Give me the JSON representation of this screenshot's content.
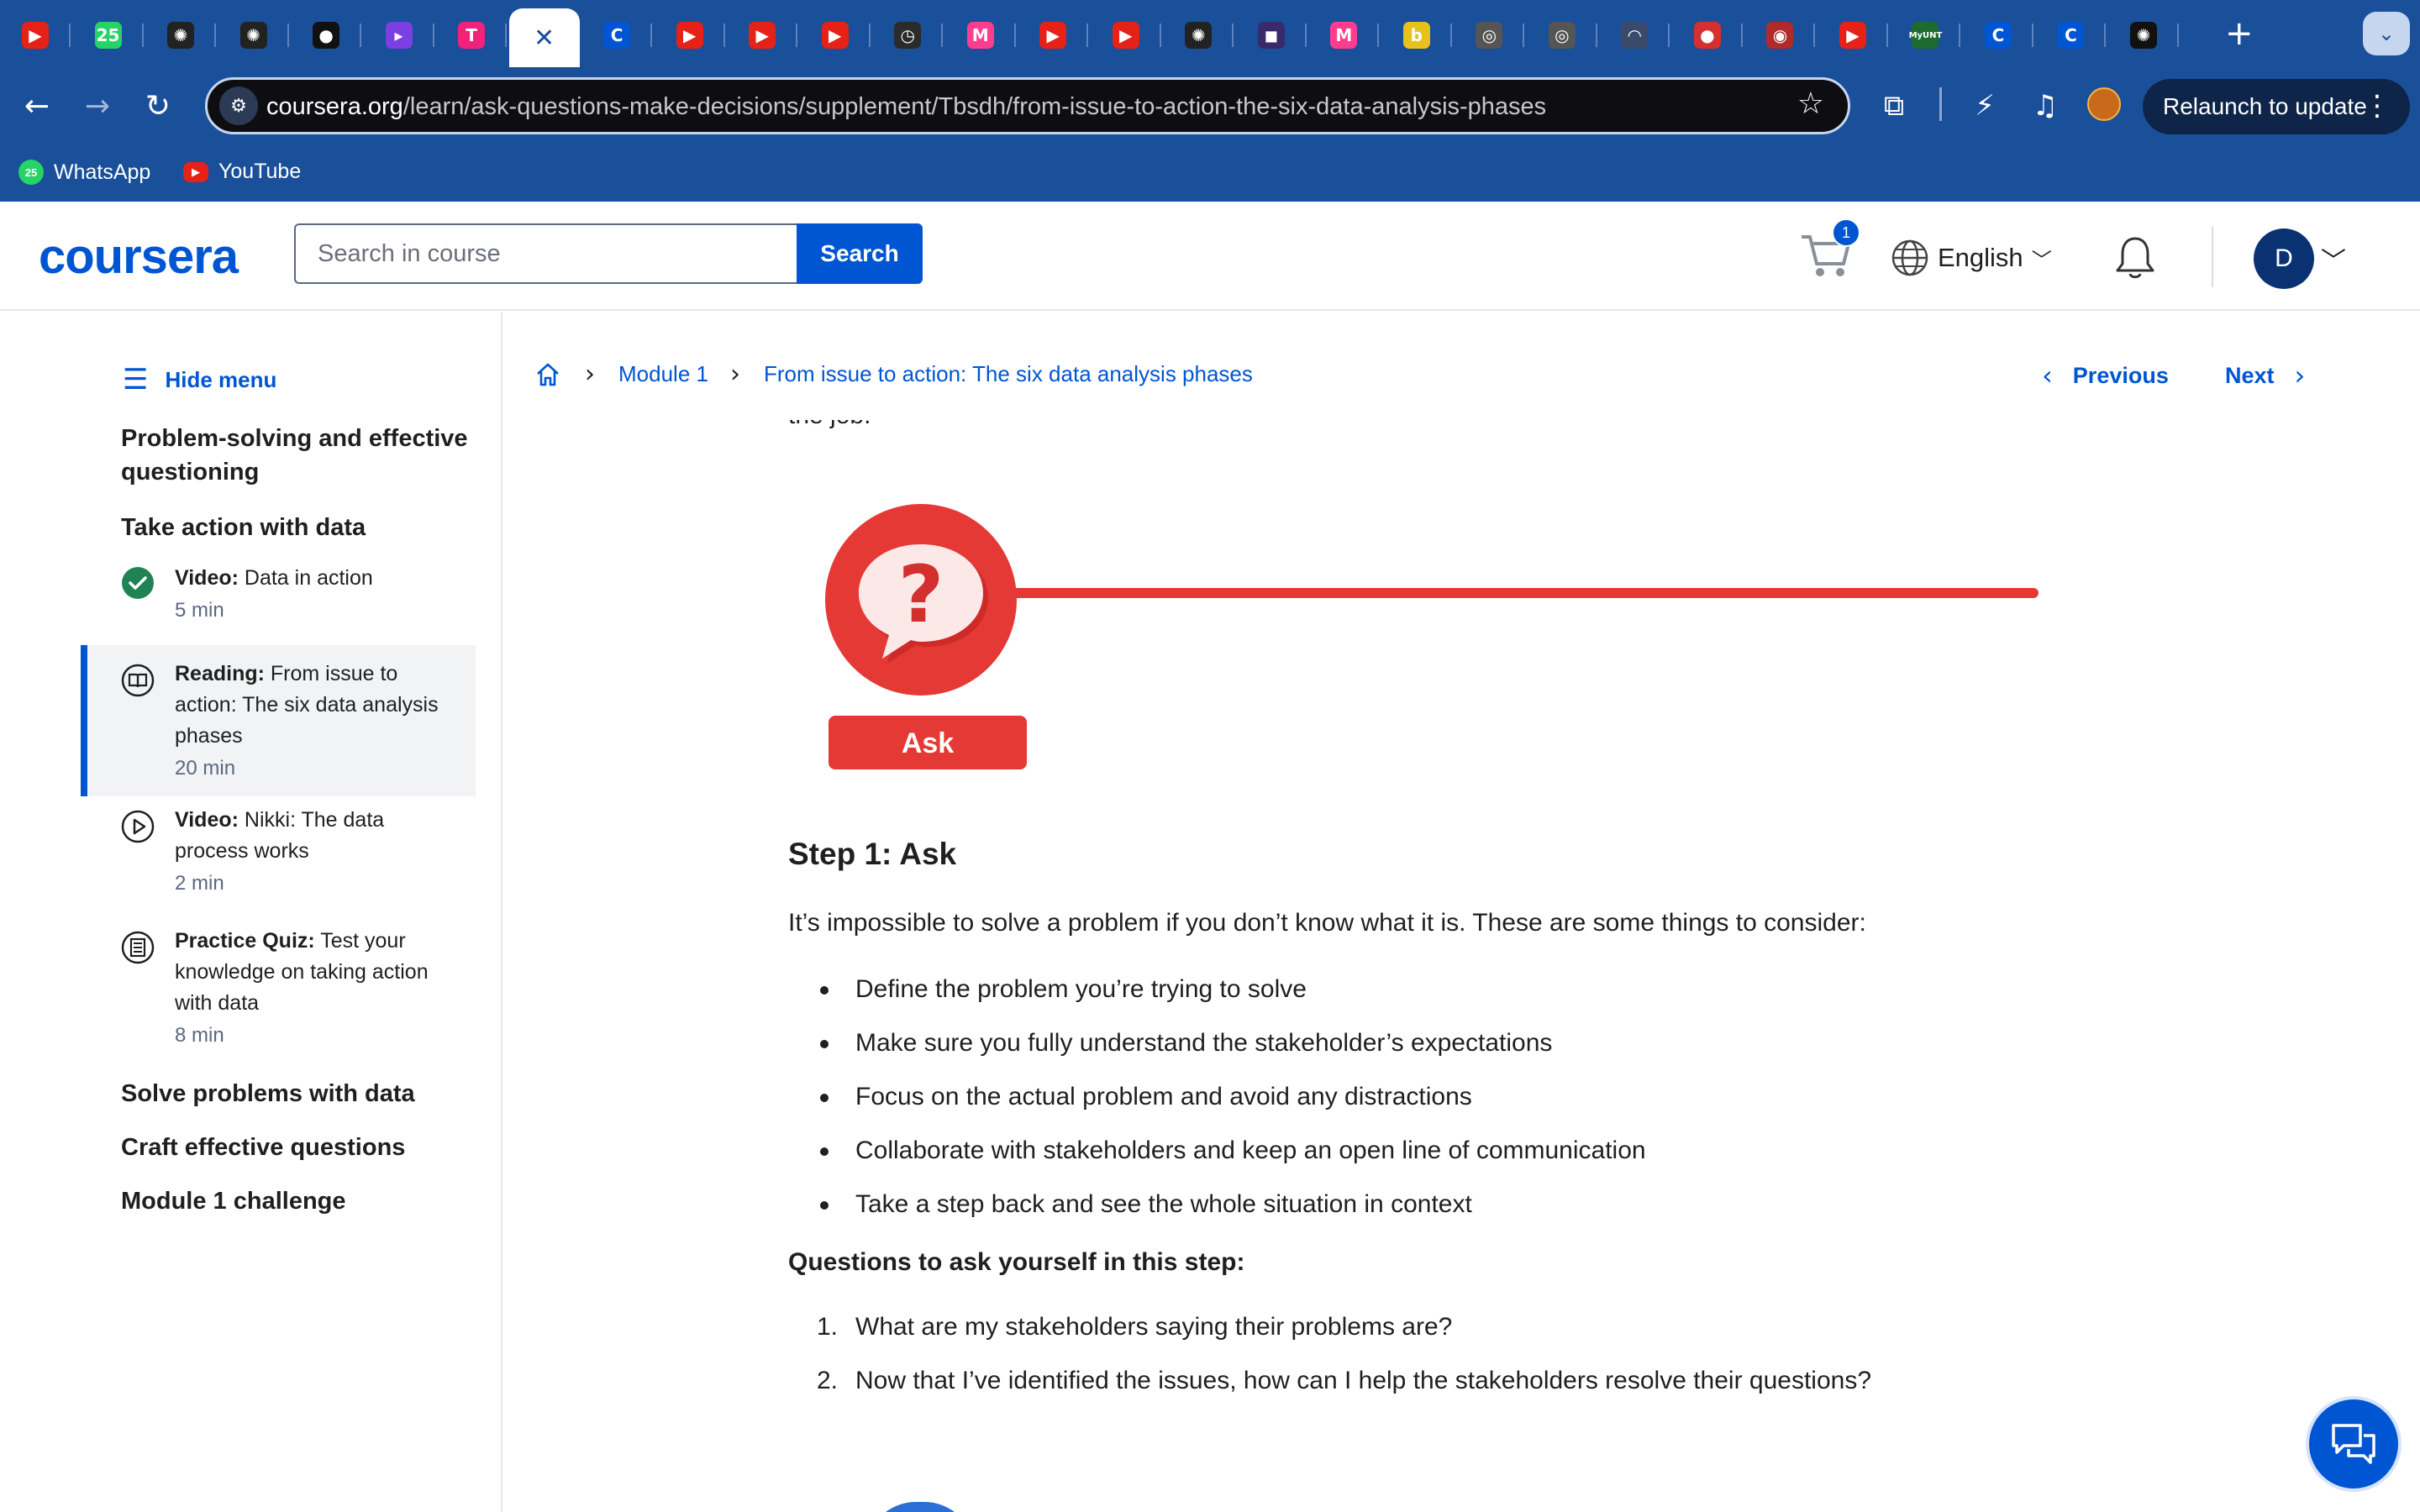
{
  "browser": {
    "tabs": [
      {
        "icon": "youtube-icon",
        "color": "#e62117",
        "glyph": "▶"
      },
      {
        "icon": "whatsapp-icon",
        "color": "#25d366",
        "glyph": "25"
      },
      {
        "icon": "openai-icon",
        "color": "#222222",
        "glyph": "✺"
      },
      {
        "icon": "openai-icon",
        "color": "#222222",
        "glyph": "✺"
      },
      {
        "icon": "github-icon",
        "color": "#111111",
        "glyph": "●"
      },
      {
        "icon": "app-icon",
        "color": "#7b3fe4",
        "glyph": "▸"
      },
      {
        "icon": "tasks-icon",
        "color": "#f0227a",
        "glyph": "T"
      },
      {
        "icon": "close-icon",
        "active": true,
        "glyph": "✕"
      },
      {
        "icon": "coursera-icon",
        "color": "#0056d2",
        "glyph": "C"
      },
      {
        "icon": "youtube-icon",
        "color": "#e62117",
        "glyph": "▶"
      },
      {
        "icon": "youtube-icon",
        "color": "#e62117",
        "glyph": "▶"
      },
      {
        "icon": "youtube-icon",
        "color": "#e62117",
        "glyph": "▶"
      },
      {
        "icon": "timer-icon",
        "color": "#2b2b2b",
        "glyph": "◷"
      },
      {
        "icon": "mural-icon",
        "color": "#ff3c8e",
        "glyph": "M"
      },
      {
        "icon": "youtube-icon",
        "color": "#e62117",
        "glyph": "▶"
      },
      {
        "icon": "youtube-icon",
        "color": "#e62117",
        "glyph": "▶"
      },
      {
        "icon": "openai-icon",
        "color": "#222222",
        "glyph": "✺"
      },
      {
        "icon": "video-icon",
        "color": "#3a2a6a",
        "glyph": "◼"
      },
      {
        "icon": "mural-icon",
        "color": "#ff3c8e",
        "glyph": "M"
      },
      {
        "icon": "circle-b-icon",
        "color": "#e8c21a",
        "glyph": "b"
      },
      {
        "icon": "target-icon",
        "color": "#555555",
        "glyph": "◎"
      },
      {
        "icon": "target-icon",
        "color": "#555555",
        "glyph": "◎"
      },
      {
        "icon": "gauge-icon",
        "color": "#3a4a6a",
        "glyph": "◠"
      },
      {
        "icon": "ball-icon",
        "color": "#d43030",
        "glyph": "●"
      },
      {
        "icon": "record-icon",
        "color": "#b02a2a",
        "glyph": "◉"
      },
      {
        "icon": "youtube-icon",
        "color": "#e62117",
        "glyph": "▶"
      },
      {
        "icon": "myunt-icon",
        "color": "#1d6b2e",
        "glyph": "MyUNT"
      },
      {
        "icon": "coursera-icon",
        "color": "#0056d2",
        "glyph": "C"
      },
      {
        "icon": "coursera-icon",
        "color": "#0056d2",
        "glyph": "C"
      },
      {
        "icon": "chatgpt-icon",
        "color": "#111111",
        "glyph": "✺"
      }
    ],
    "new_tab_glyph": "+",
    "tab_list_glyph": "⌄",
    "url_host": "coursera.org",
    "url_path": "/learn/ask-questions-make-decisions/supplement/Tbsdh/from-issue-to-action-the-six-data-analysis-phases",
    "relaunch_label": "Relaunch to update",
    "bookmarks": [
      {
        "label": "WhatsApp",
        "icon": "whatsapp-icon",
        "color": "#25d366",
        "badge": "25"
      },
      {
        "label": "YouTube",
        "icon": "youtube-icon",
        "color": "#e62117",
        "badge": "▶"
      }
    ]
  },
  "header": {
    "logo": "coursera",
    "search_placeholder": "Search in course",
    "search_button": "Search",
    "cart_count": "1",
    "language": "English",
    "avatar_initial": "D",
    "brand_color": "#0056d2"
  },
  "sidebar": {
    "hide_menu": "Hide menu",
    "sections": [
      "Problem-solving and effective questioning",
      "Take action with data",
      "Solve problems with data",
      "Craft effective questions",
      "Module 1 challenge"
    ],
    "items": [
      {
        "type": "Video:",
        "title": "Data in action",
        "meta": "5 min",
        "icon": "check-circle-icon",
        "completed": true
      },
      {
        "type": "Reading:",
        "title": "From issue to action: The six data analysis phases",
        "meta": "20 min",
        "icon": "book-icon",
        "active": true
      },
      {
        "type": "Video:",
        "title": "Nikki: The data process works",
        "meta": "2 min",
        "icon": "play-circle-icon"
      },
      {
        "type": "Practice Quiz:",
        "title": "Test your knowledge on taking action with data",
        "meta": "8 min",
        "icon": "quiz-icon"
      }
    ]
  },
  "main": {
    "breadcrumbs": [
      "Module 1",
      "From issue to action: The six data analysis phases"
    ],
    "previous": "Previous",
    "next": "Next",
    "cut_off_text": "the job.",
    "illustration": {
      "label": "Ask",
      "accent": "#e53935"
    },
    "step_title": "Step 1: Ask",
    "intro": "It’s impossible to solve a problem if you don’t know what it is. These are some things to consider:",
    "bullets": [
      "Define the problem you’re trying to solve",
      "Make sure you fully understand the stakeholder’s expectations",
      "Focus on the actual problem and avoid any distractions",
      "Collaborate with stakeholders and keep an open line of communication",
      "Take a step back and see the whole situation in context"
    ],
    "questions_heading": "Questions to ask yourself in this step:",
    "questions": [
      {
        "num": "1.",
        "text": "What are my stakeholders saying their problems are?"
      },
      {
        "num": "2.",
        "text": "Now that I’ve identified the issues, how can I help the stakeholders resolve their questions?"
      }
    ]
  }
}
